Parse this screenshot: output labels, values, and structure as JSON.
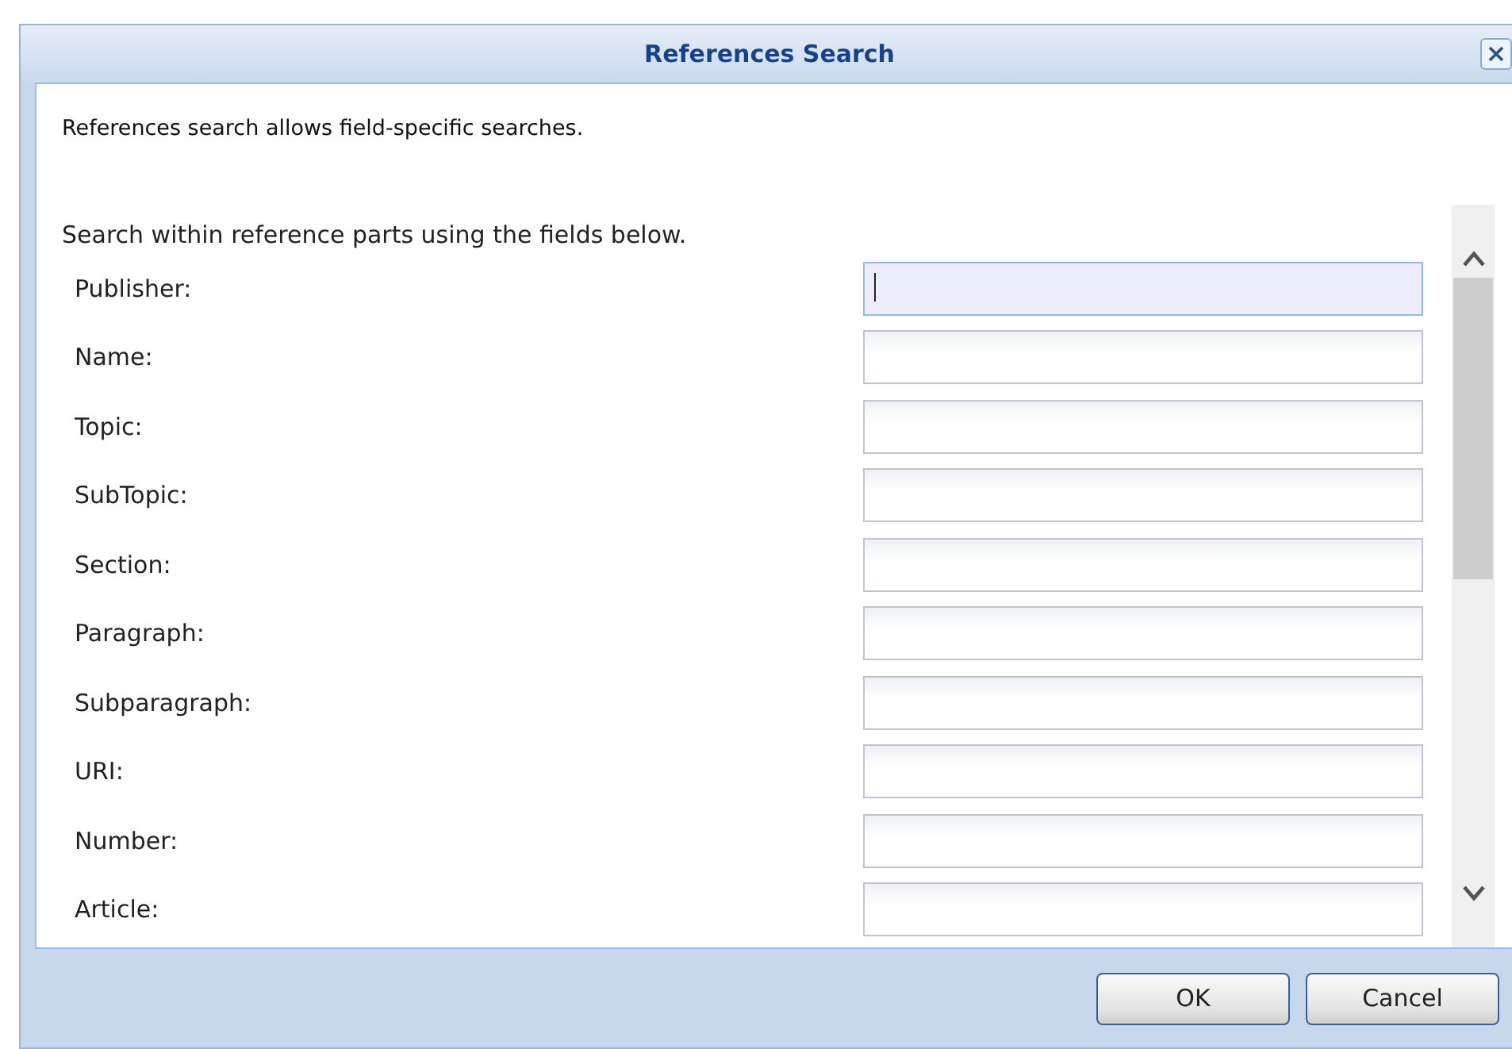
{
  "window": {
    "title": "References Search"
  },
  "intro": "References search allows field-specific searches.",
  "instructions": "Search within reference parts using the fields below.",
  "fields": [
    {
      "label": "Publisher:",
      "focused": true
    },
    {
      "label": "Name:",
      "focused": false
    },
    {
      "label": "Topic:",
      "focused": false
    },
    {
      "label": "SubTopic:",
      "focused": false
    },
    {
      "label": "Section:",
      "focused": false
    },
    {
      "label": "Paragraph:",
      "focused": false
    },
    {
      "label": "Subparagraph:",
      "focused": false
    },
    {
      "label": "URI:",
      "focused": false
    },
    {
      "label": "Number:",
      "focused": false
    },
    {
      "label": "Article:",
      "focused": false
    }
  ],
  "buttons": [
    "OK",
    "Cancel"
  ]
}
